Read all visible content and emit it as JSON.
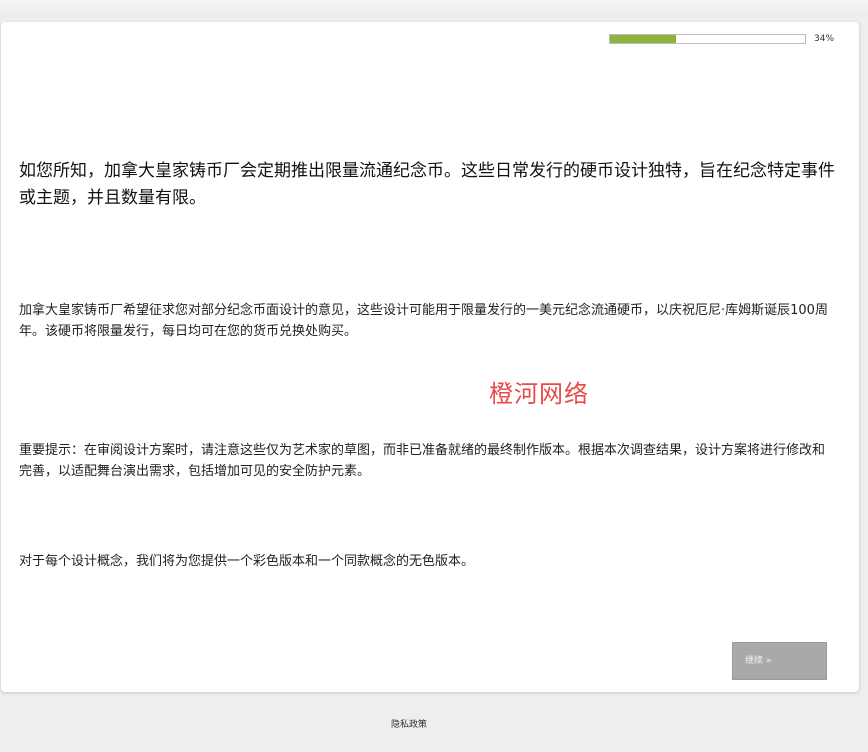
{
  "progress": {
    "percent": 34,
    "label": "34%"
  },
  "content": {
    "intro": "如您所知，加拿大皇家铸币厂会定期推出限量流通纪念币。这些日常发行的硬币设计独特，旨在纪念特定事件或主题，并且数量有限。",
    "paragraph_1": "加拿大皇家铸币厂希望征求您对部分纪念币面设计的意见，这些设计可能用于限量发行的一美元纪念流通硬币，以庆祝厄尼·库姆斯诞辰100周年。该硬币将限量发行，每日均可在您的货币兑换处购买。",
    "watermark": "橙河网络",
    "paragraph_2": "重要提示：在审阅设计方案时，请注意这些仅为艺术家的草图，而非已准备就绪的最终制作版本。根据本次调查结果，设计方案将进行修改和完善，以适配舞台演出需求，包括增加可见的安全防护元素。",
    "paragraph_3": "对于每个设计概念，我们将为您提供一个彩色版本和一个同款概念的无色版本。"
  },
  "actions": {
    "next_label": "继续 »"
  },
  "footer": {
    "privacy_label": "隐私政策"
  },
  "colors": {
    "progress_fill": "#8fb13d",
    "watermark": "#e84a4a",
    "button_bg": "#a9a9a9"
  }
}
